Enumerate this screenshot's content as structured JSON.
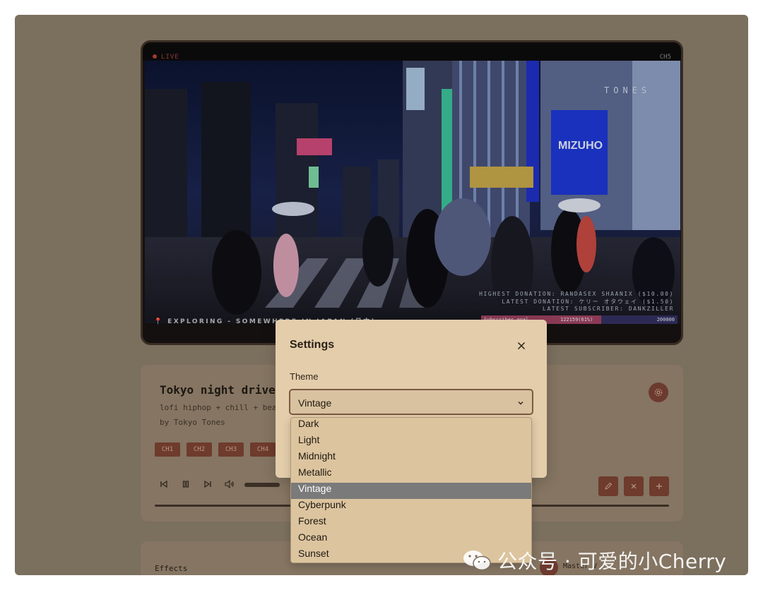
{
  "tv": {
    "live_label": "LIVE",
    "channel": "CH5",
    "sign_text": "TONES",
    "sign_mizuho": "MIZUHO",
    "overlay": {
      "highest_donation": "HIGHEST DONATION: RANDASEX SHAANIX ($10.00)",
      "latest_donation": "LATEST DONATION: ケリー オタウェイ ($1.50)",
      "latest_subscriber": "LATEST SUBSCRIBER: DANKZILLER"
    },
    "location": "EXPLORING - SOMEWHERE IN JAPAN (日本)",
    "subscriber_goal": {
      "label": "Subscriber goal",
      "current": "122159(61%)",
      "target": "200000",
      "progress": 0.61
    }
  },
  "player": {
    "title": "Tokyo night drive",
    "genre": "lofi hiphop + chill + beats",
    "artist": "by Tokyo Tones",
    "channels": [
      "CH1",
      "CH2",
      "CH3",
      "CH4"
    ]
  },
  "effects": {
    "label": "Effects",
    "master_label": "Master V"
  },
  "modal": {
    "title": "Settings",
    "theme_label": "Theme",
    "theme_value": "Vintage",
    "theme_options": [
      "Dark",
      "Light",
      "Midnight",
      "Metallic",
      "Vintage",
      "Cyberpunk",
      "Forest",
      "Ocean",
      "Sunset"
    ],
    "selected_index": 4
  },
  "watermark": {
    "text": "公众号 · 可爱的小Cherry"
  },
  "colors": {
    "backdrop": "#7b6f5e",
    "modal_bg": "#e4cdab",
    "accent": "#6e3b2c",
    "selected_option": "#7a7a7a"
  }
}
